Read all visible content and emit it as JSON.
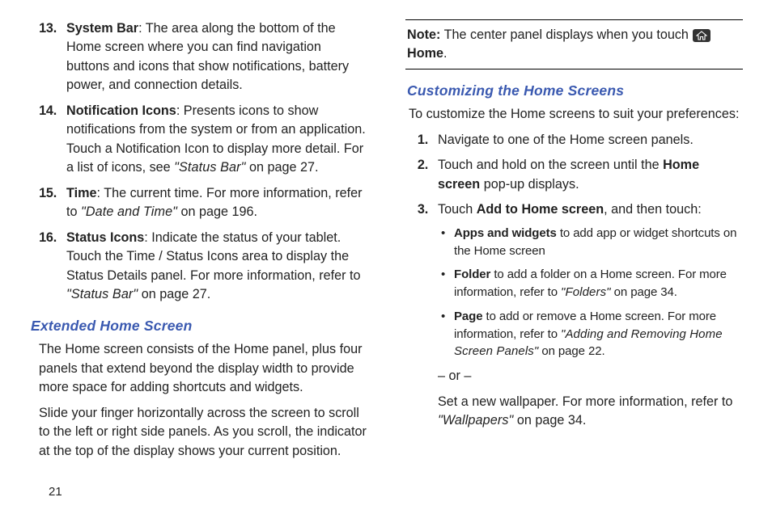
{
  "left": {
    "items": [
      {
        "num": "13.",
        "term": "System Bar",
        "text": ": The area along the bottom of the Home screen where you can find navigation buttons and icons that show notifications, battery power, and connection details."
      },
      {
        "num": "14.",
        "term": "Notification Icons",
        "text_a": ": Presents icons to show notifications from the system or from an application. Touch a Notification Icon to display more detail. For a list of icons, see ",
        "ital": "\"Status Bar\"",
        "text_b": " on page 27."
      },
      {
        "num": "15.",
        "term": "Time",
        "text_a": ": The current time. For more information, refer to ",
        "ital": "\"Date and Time\"",
        "text_b": "  on page 196."
      },
      {
        "num": "16.",
        "term": "Status Icons",
        "text_a": ": Indicate the status of your tablet. Touch the Time / Status Icons area to display the Status Details panel. For more information, refer to ",
        "ital": "\"Status Bar\"",
        "text_b": "  on page 27."
      }
    ],
    "heading": "Extended Home Screen",
    "p1": "The Home screen consists of the Home panel, plus four panels that extend beyond the display width to provide more space for adding shortcuts and widgets.",
    "p2": "Slide your finger horizontally across the screen to scroll to the left or right side panels. As you scroll, the indicator at the top of the display shows your current position."
  },
  "right": {
    "note_label": "Note:",
    "note_text_a": " The center panel displays when you touch ",
    "note_home": "Home",
    "note_text_b": ".",
    "heading": "Customizing the Home Screens",
    "intro": "To customize the Home screens to suit your preferences:",
    "steps": [
      {
        "num": "1.",
        "text": "Navigate to one of the Home screen panels."
      },
      {
        "num": "2.",
        "text_a": "Touch and hold on the screen until the ",
        "bold": "Home screen",
        "text_b": " pop-up displays."
      },
      {
        "num": "3.",
        "text_a": "Touch ",
        "bold": "Add to Home screen",
        "text_b": ", and then touch:",
        "bullets": [
          {
            "bold": "Apps and widgets",
            "text": " to add app or widget shortcuts on the Home screen"
          },
          {
            "bold": "Folder",
            "text_a": " to add a folder on a Home screen. For more information, refer to ",
            "ital": "\"Folders\"",
            "text_b": "  on page 34."
          },
          {
            "bold": "Page",
            "text_a": " to add or remove a Home screen. For more information, refer to ",
            "ital": "\"Adding and Removing Home Screen Panels\"",
            "text_b": "  on page 22."
          }
        ],
        "or": "– or –",
        "after_a": "Set a new wallpaper. For more information, refer to ",
        "after_ital": "\"Wallpapers\"",
        "after_b": "  on page 34."
      }
    ]
  },
  "page_number": "21"
}
